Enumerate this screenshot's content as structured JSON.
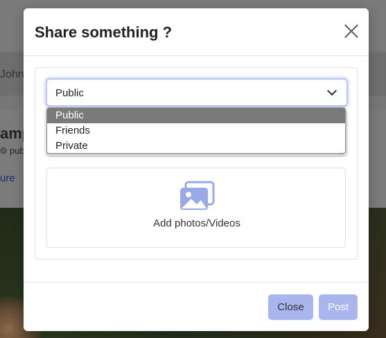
{
  "background": {
    "name_fragment": "John",
    "title_fragment": "amp",
    "privacy_fragment": "pub",
    "link_fragment": "ure"
  },
  "modal": {
    "title": "Share something ?",
    "close_icon": "close-icon",
    "privacy_select": {
      "value": "Public",
      "options": [
        "Public",
        "Friends",
        "Private"
      ],
      "highlighted": "Public"
    },
    "upload": {
      "icon": "images-icon",
      "label": "Add photos/Videos"
    },
    "footer": {
      "close_label": "Close",
      "post_label": "Post"
    }
  },
  "colors": {
    "accent": "#a9b6ee",
    "focus_ring": "#b9c4f2",
    "option_highlight": "#7a7a7a"
  }
}
